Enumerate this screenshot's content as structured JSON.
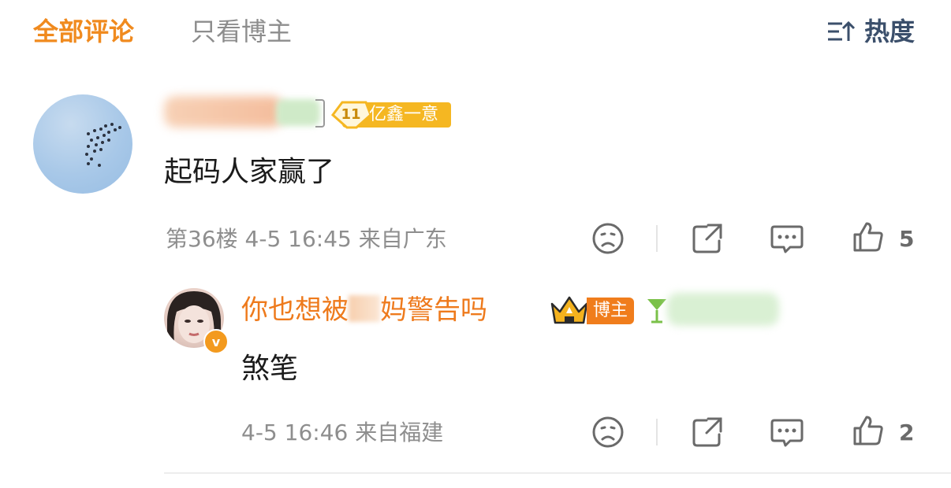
{
  "header": {
    "tabs": [
      {
        "label": "全部评论",
        "active": true
      },
      {
        "label": "只看博主",
        "active": false
      }
    ],
    "sort_label": "热度",
    "accent_color": "#f08a1e"
  },
  "comments": [
    {
      "fan_badge": {
        "level": "11",
        "text": "亿鑫一意"
      },
      "text": "起码人家赢了",
      "meta": "第36楼 4-5 16:45 来自广东",
      "like_count": "5",
      "reply": {
        "username": "你也想被",
        "username_tail": "妈警告吗",
        "role_tag": "博主",
        "verified_badge": "v",
        "text": "煞笔",
        "meta": "4-5 16:46 来自福建",
        "like_count": "2"
      }
    }
  ],
  "icons": [
    "sort-icon",
    "dislike-icon",
    "share-icon",
    "reply-icon",
    "like-icon",
    "crown-icon",
    "cocktail-icon",
    "verified-icon"
  ]
}
